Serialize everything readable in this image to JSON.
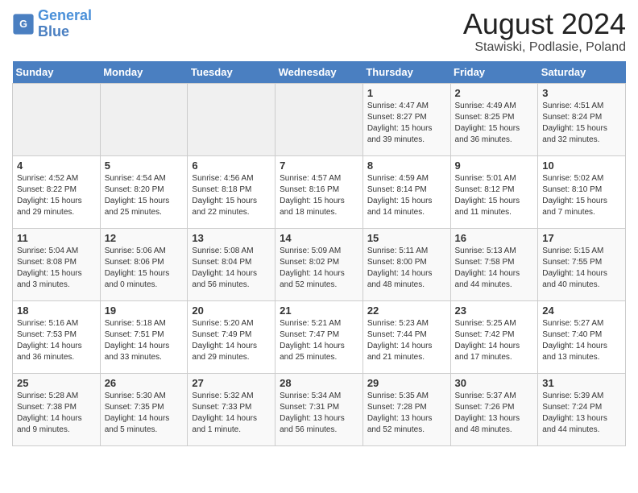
{
  "header": {
    "logo_line1": "General",
    "logo_line2": "Blue",
    "main_title": "August 2024",
    "subtitle": "Stawiski, Podlasie, Poland"
  },
  "weekdays": [
    "Sunday",
    "Monday",
    "Tuesday",
    "Wednesday",
    "Thursday",
    "Friday",
    "Saturday"
  ],
  "weeks": [
    [
      {
        "num": "",
        "info": ""
      },
      {
        "num": "",
        "info": ""
      },
      {
        "num": "",
        "info": ""
      },
      {
        "num": "",
        "info": ""
      },
      {
        "num": "1",
        "info": "Sunrise: 4:47 AM\nSunset: 8:27 PM\nDaylight: 15 hours\nand 39 minutes."
      },
      {
        "num": "2",
        "info": "Sunrise: 4:49 AM\nSunset: 8:25 PM\nDaylight: 15 hours\nand 36 minutes."
      },
      {
        "num": "3",
        "info": "Sunrise: 4:51 AM\nSunset: 8:24 PM\nDaylight: 15 hours\nand 32 minutes."
      }
    ],
    [
      {
        "num": "4",
        "info": "Sunrise: 4:52 AM\nSunset: 8:22 PM\nDaylight: 15 hours\nand 29 minutes."
      },
      {
        "num": "5",
        "info": "Sunrise: 4:54 AM\nSunset: 8:20 PM\nDaylight: 15 hours\nand 25 minutes."
      },
      {
        "num": "6",
        "info": "Sunrise: 4:56 AM\nSunset: 8:18 PM\nDaylight: 15 hours\nand 22 minutes."
      },
      {
        "num": "7",
        "info": "Sunrise: 4:57 AM\nSunset: 8:16 PM\nDaylight: 15 hours\nand 18 minutes."
      },
      {
        "num": "8",
        "info": "Sunrise: 4:59 AM\nSunset: 8:14 PM\nDaylight: 15 hours\nand 14 minutes."
      },
      {
        "num": "9",
        "info": "Sunrise: 5:01 AM\nSunset: 8:12 PM\nDaylight: 15 hours\nand 11 minutes."
      },
      {
        "num": "10",
        "info": "Sunrise: 5:02 AM\nSunset: 8:10 PM\nDaylight: 15 hours\nand 7 minutes."
      }
    ],
    [
      {
        "num": "11",
        "info": "Sunrise: 5:04 AM\nSunset: 8:08 PM\nDaylight: 15 hours\nand 3 minutes."
      },
      {
        "num": "12",
        "info": "Sunrise: 5:06 AM\nSunset: 8:06 PM\nDaylight: 15 hours\nand 0 minutes."
      },
      {
        "num": "13",
        "info": "Sunrise: 5:08 AM\nSunset: 8:04 PM\nDaylight: 14 hours\nand 56 minutes."
      },
      {
        "num": "14",
        "info": "Sunrise: 5:09 AM\nSunset: 8:02 PM\nDaylight: 14 hours\nand 52 minutes."
      },
      {
        "num": "15",
        "info": "Sunrise: 5:11 AM\nSunset: 8:00 PM\nDaylight: 14 hours\nand 48 minutes."
      },
      {
        "num": "16",
        "info": "Sunrise: 5:13 AM\nSunset: 7:58 PM\nDaylight: 14 hours\nand 44 minutes."
      },
      {
        "num": "17",
        "info": "Sunrise: 5:15 AM\nSunset: 7:55 PM\nDaylight: 14 hours\nand 40 minutes."
      }
    ],
    [
      {
        "num": "18",
        "info": "Sunrise: 5:16 AM\nSunset: 7:53 PM\nDaylight: 14 hours\nand 36 minutes."
      },
      {
        "num": "19",
        "info": "Sunrise: 5:18 AM\nSunset: 7:51 PM\nDaylight: 14 hours\nand 33 minutes."
      },
      {
        "num": "20",
        "info": "Sunrise: 5:20 AM\nSunset: 7:49 PM\nDaylight: 14 hours\nand 29 minutes."
      },
      {
        "num": "21",
        "info": "Sunrise: 5:21 AM\nSunset: 7:47 PM\nDaylight: 14 hours\nand 25 minutes."
      },
      {
        "num": "22",
        "info": "Sunrise: 5:23 AM\nSunset: 7:44 PM\nDaylight: 14 hours\nand 21 minutes."
      },
      {
        "num": "23",
        "info": "Sunrise: 5:25 AM\nSunset: 7:42 PM\nDaylight: 14 hours\nand 17 minutes."
      },
      {
        "num": "24",
        "info": "Sunrise: 5:27 AM\nSunset: 7:40 PM\nDaylight: 14 hours\nand 13 minutes."
      }
    ],
    [
      {
        "num": "25",
        "info": "Sunrise: 5:28 AM\nSunset: 7:38 PM\nDaylight: 14 hours\nand 9 minutes."
      },
      {
        "num": "26",
        "info": "Sunrise: 5:30 AM\nSunset: 7:35 PM\nDaylight: 14 hours\nand 5 minutes."
      },
      {
        "num": "27",
        "info": "Sunrise: 5:32 AM\nSunset: 7:33 PM\nDaylight: 14 hours\nand 1 minute."
      },
      {
        "num": "28",
        "info": "Sunrise: 5:34 AM\nSunset: 7:31 PM\nDaylight: 13 hours\nand 56 minutes."
      },
      {
        "num": "29",
        "info": "Sunrise: 5:35 AM\nSunset: 7:28 PM\nDaylight: 13 hours\nand 52 minutes."
      },
      {
        "num": "30",
        "info": "Sunrise: 5:37 AM\nSunset: 7:26 PM\nDaylight: 13 hours\nand 48 minutes."
      },
      {
        "num": "31",
        "info": "Sunrise: 5:39 AM\nSunset: 7:24 PM\nDaylight: 13 hours\nand 44 minutes."
      }
    ]
  ]
}
